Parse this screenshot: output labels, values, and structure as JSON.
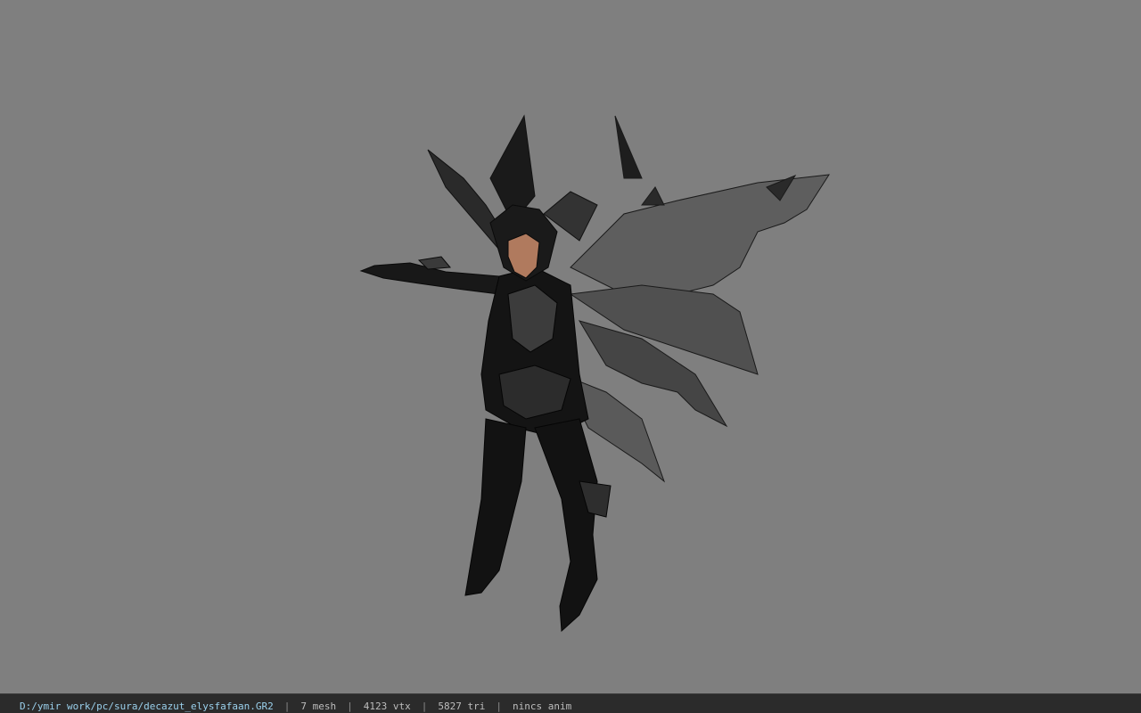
{
  "viewer": {
    "background_color": "#7f7f7f",
    "model_subject": "dark-armored-winged-warrior"
  },
  "status": {
    "file_path": "D:/ymir work/pc/sura/decazut_elysfafaan.GR2",
    "separator": "|",
    "mesh": "7 mesh",
    "vertices": "4123 vtx",
    "triangles": "5827 tri",
    "animation": "nincs anim",
    "path_color": "#9ad0ec",
    "text_color": "#bdbdbd"
  }
}
